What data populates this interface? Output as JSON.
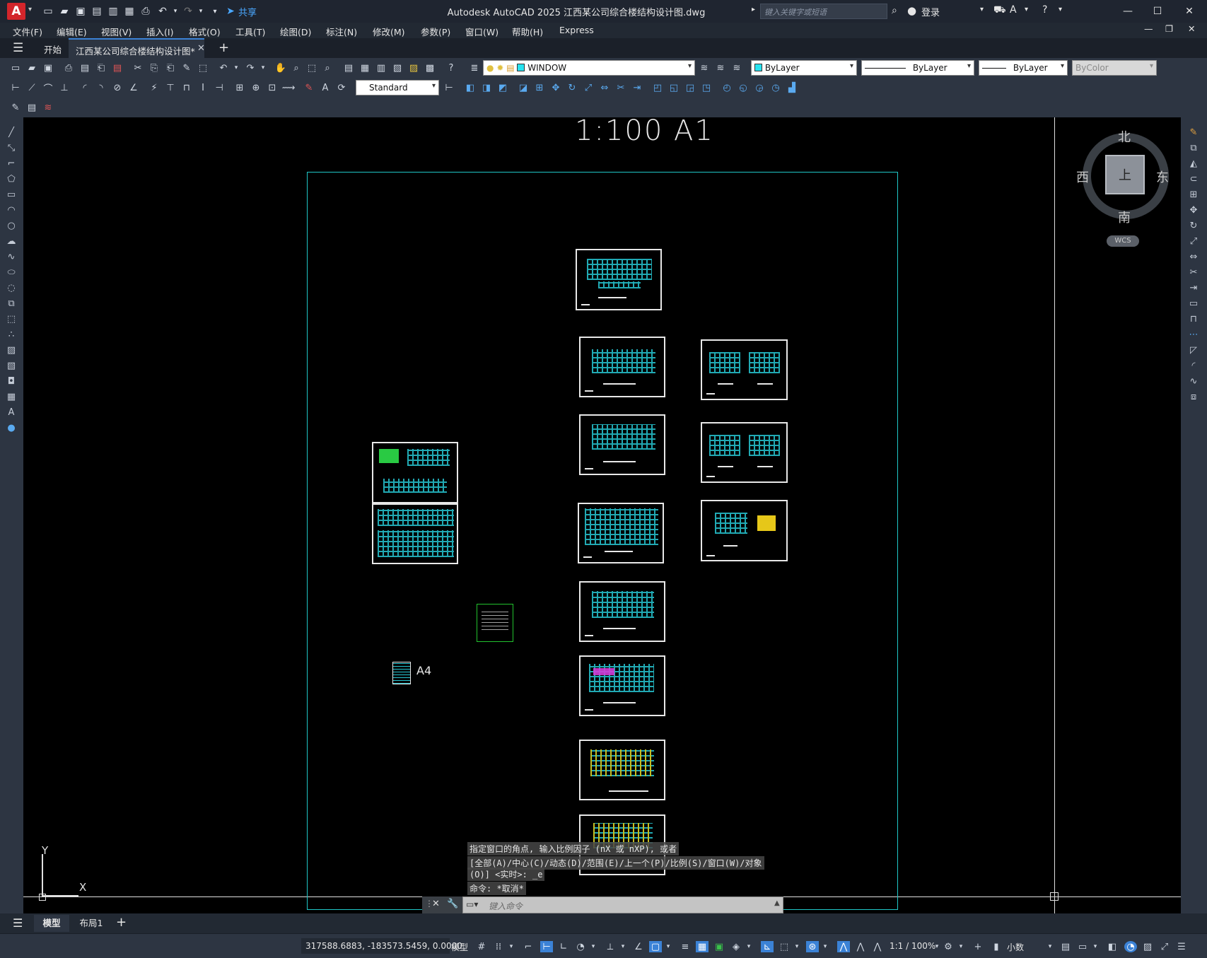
{
  "app": {
    "logo": "A",
    "window_title": "Autodesk AutoCAD 2025    江西某公司综合楼结构设计图.dwg",
    "share_label": "共享",
    "search_placeholder": "键入关键字或短语",
    "login_label": "登录"
  },
  "menu": [
    "文件(F)",
    "编辑(E)",
    "视图(V)",
    "插入(I)",
    "格式(O)",
    "工具(T)",
    "绘图(D)",
    "标注(N)",
    "修改(M)",
    "参数(P)",
    "窗口(W)",
    "帮助(H)",
    "Express"
  ],
  "tabs": {
    "home": "开始",
    "document": "江西某公司综合楼结构设计图*"
  },
  "toolbar": {
    "layer_value": "WINDOW",
    "color_value": "ByLayer",
    "linetype_value": "ByLayer",
    "lineweight_value": "ByLayer",
    "plotstyle_value": "ByColor",
    "dimstyle_value": "Standard"
  },
  "drawing": {
    "sheet_title": "1:100 A1",
    "a4_label": "A4",
    "ucs_y": "Y",
    "ucs_x": "X"
  },
  "viewcube": {
    "north": "北",
    "south": "南",
    "east": "东",
    "west": "西",
    "face": "上",
    "wcs": "WCS"
  },
  "command": {
    "history_1": "指定窗口的角点, 输入比例因子 (nX 或 nXP), 或者",
    "history_2": "[全部(A)/中心(C)/动态(D)/范围(E)/上一个(P)/比例(S)/窗口(W)/对象",
    "history_3": "(O)] <实时>: _e",
    "history_4": "命令: *取消*",
    "input_placeholder": "键入命令"
  },
  "layout_tabs": {
    "model": "模型",
    "layout1": "布局1"
  },
  "status": {
    "coordinates": "317588.6883, -183573.5459, 0.0000",
    "space": "模型",
    "scale": "1:1 / 100%",
    "units": "小数"
  },
  "colors": {
    "accent_blue": "#3b82d6",
    "drawing_cyan": "#27c7d3",
    "logo_red": "#d3252b",
    "canvas_black": "#000000"
  }
}
